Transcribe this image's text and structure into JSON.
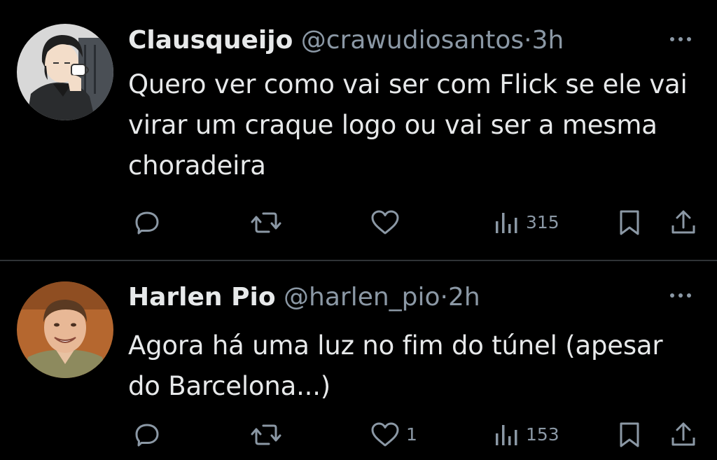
{
  "tweets": [
    {
      "display_name": "Clausqueijo",
      "handle": "@crawudiosantos",
      "separator": "·",
      "time": "3h",
      "text": "Quero ver como vai ser com Flick se ele vai virar um craque logo ou vai ser a mesma choradeira",
      "replies": "",
      "retweets": "",
      "likes": "",
      "views": "315",
      "avatar": "anime-man-drinking-coffee"
    },
    {
      "display_name": "Harlen Pio",
      "handle": "@harlen_pio",
      "separator": "·",
      "time": "2h",
      "text": "Agora há uma luz no fim do túnel (apesar do Barcelona...)",
      "replies": "",
      "retweets": "",
      "likes": "1",
      "views": "153",
      "avatar": "smiling-man-photo"
    }
  ],
  "icons": {
    "reply": "reply-icon",
    "retweet": "retweet-icon",
    "like": "like-icon",
    "views": "views-icon",
    "bookmark": "bookmark-icon",
    "share": "share-icon",
    "more": "more-icon"
  },
  "colors": {
    "background": "#000000",
    "primary_text": "#e7e9ea",
    "secondary_text": "#8b98a5",
    "divider": "#2f3336"
  }
}
